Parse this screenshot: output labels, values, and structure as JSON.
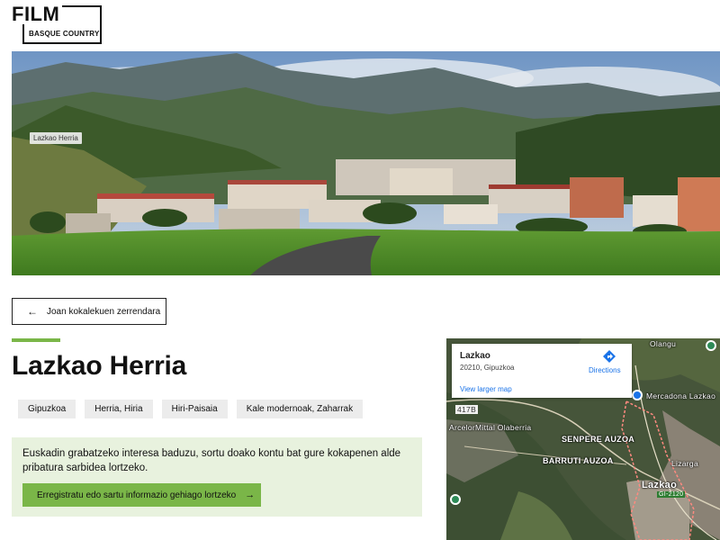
{
  "logo": {
    "line1": "FILM",
    "line2": "BASQUE COUNTRY"
  },
  "hero": {
    "caption": "Lazkao Herria"
  },
  "back_button": {
    "label": "Joan kokalekuen zerrendara",
    "icon": "arrow-left-icon"
  },
  "page": {
    "title": "Lazkao Herria"
  },
  "tags": [
    "Gipuzkoa",
    "Herria, Hiria",
    "Hiri-Paisaia",
    "Kale modernoak, Zaharrak"
  ],
  "promo": {
    "text": "Euskadin grabatzeko interesa baduzu, sortu doako kontu bat gure kokapenen alde pribatura sarbidea lortzeko.",
    "button_label": "Erregistratu edo sartu informazio gehiago lortzeko",
    "button_icon": "arrow-right-icon"
  },
  "map": {
    "place": "Lazkao",
    "address": "20210, Gipuzkoa",
    "directions_label": "Directions",
    "larger_map_label": "View larger map",
    "labels": {
      "olangu": "Olangu",
      "mercadona": "Mercadona Lazkao",
      "road_a": "417B",
      "arcelor": "ArcelorMittal Olaberria",
      "senpere": "SENPERE AUZOA",
      "barruti": "BARRUTI AUZOA",
      "lizarga": "Lizarga",
      "town": "Lazkao",
      "road_b": "GI-2120"
    }
  },
  "colors": {
    "accent": "#7ab648",
    "promo_bg": "#e8f2de",
    "tag_bg": "#ececec",
    "link": "#1a73e8"
  }
}
